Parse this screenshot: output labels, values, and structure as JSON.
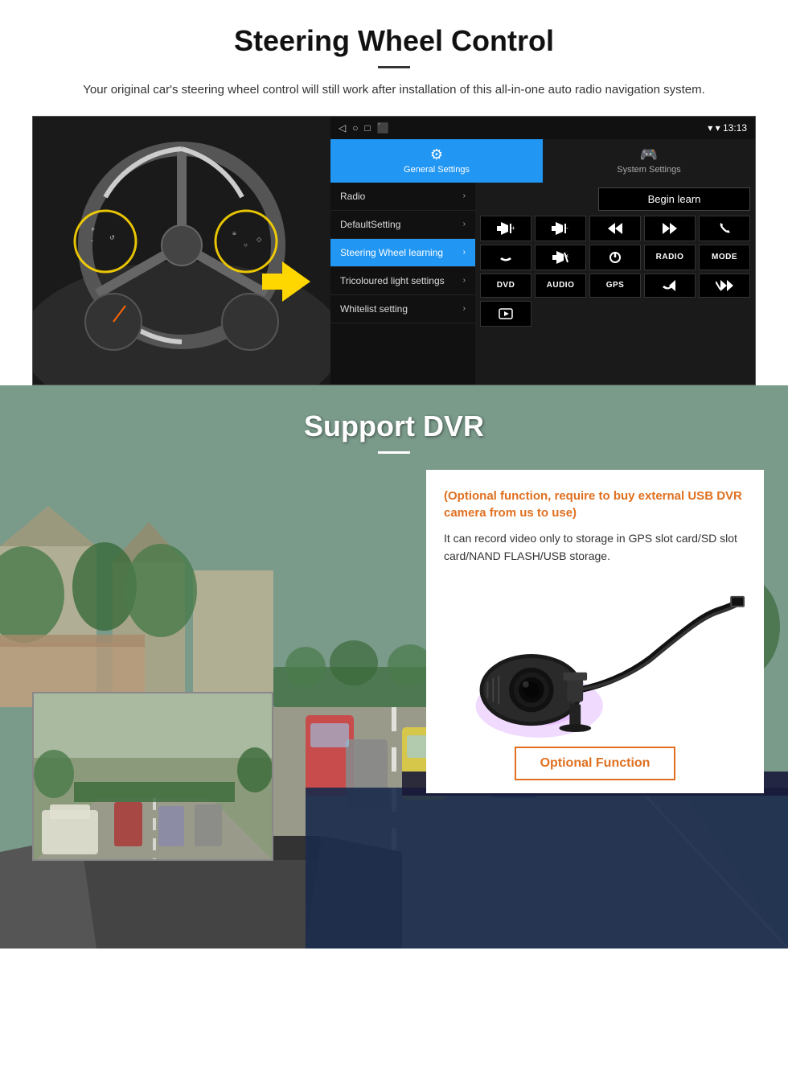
{
  "section1": {
    "title": "Steering Wheel Control",
    "subtitle": "Your original car's steering wheel control will still work after installation of this all-in-one auto radio navigation system.",
    "status_bar": {
      "time": "13:13",
      "icons": [
        "◁",
        "○",
        "□",
        "⬛"
      ]
    },
    "tabs": [
      {
        "label": "General Settings",
        "icon": "⚙",
        "active": true
      },
      {
        "label": "System Settings",
        "icon": "🎮",
        "active": false
      }
    ],
    "menu_items": [
      {
        "label": "Radio",
        "active": false
      },
      {
        "label": "DefaultSetting",
        "active": false
      },
      {
        "label": "Steering Wheel learning",
        "active": true
      },
      {
        "label": "Tricoloured light settings",
        "active": false
      },
      {
        "label": "Whitelist setting",
        "active": false
      }
    ],
    "begin_learn": "Begin learn",
    "control_buttons": [
      {
        "label": "▐◀+",
        "row": 1
      },
      {
        "label": "▐◀-",
        "row": 1
      },
      {
        "label": "⏮",
        "row": 1
      },
      {
        "label": "⏭",
        "row": 1
      },
      {
        "label": "📞",
        "row": 1
      },
      {
        "label": "↩",
        "row": 2
      },
      {
        "label": "🔇×",
        "row": 2
      },
      {
        "label": "⏻",
        "row": 2
      },
      {
        "label": "RADIO",
        "row": 2
      },
      {
        "label": "MODE",
        "row": 2
      },
      {
        "label": "DVD",
        "row": 3
      },
      {
        "label": "AUDIO",
        "row": 3
      },
      {
        "label": "GPS",
        "row": 3
      },
      {
        "label": "📞⏮",
        "row": 3
      },
      {
        "label": "✂⏭",
        "row": 3
      },
      {
        "label": "🎬",
        "row": 4
      }
    ]
  },
  "section2": {
    "title": "Support DVR",
    "optional_text": "(Optional function, require to buy external USB DVR camera from us to use)",
    "desc_text": "It can record video only to storage in GPS slot card/SD slot card/NAND FLASH/USB storage.",
    "optional_function_btn": "Optional Function"
  }
}
